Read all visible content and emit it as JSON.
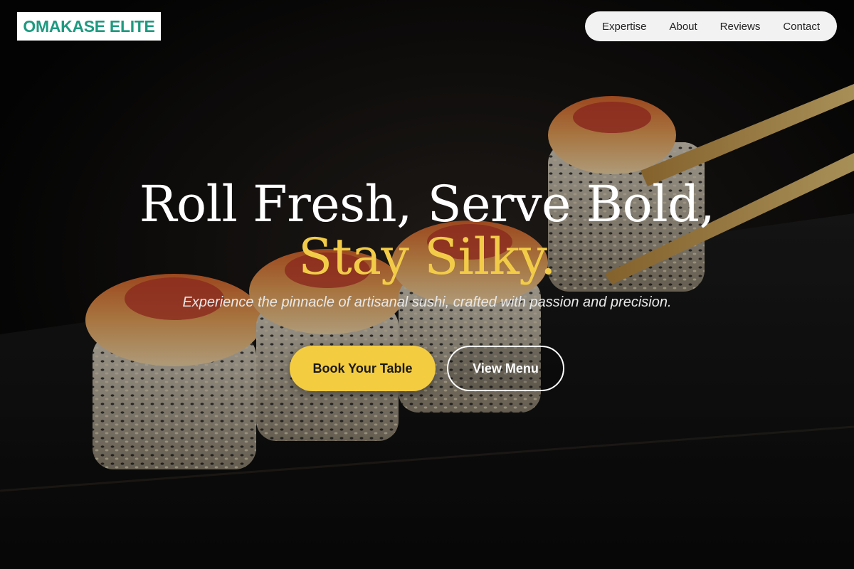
{
  "brand": {
    "logo_text": "OMAKASE ELITE",
    "logo_color": "#1f9a80"
  },
  "nav": {
    "items": [
      {
        "label": "Expertise"
      },
      {
        "label": "About"
      },
      {
        "label": "Reviews"
      },
      {
        "label": "Contact"
      }
    ]
  },
  "hero": {
    "headline_line1": "Roll Fresh, Serve Bold,",
    "headline_line2": "Stay Silky.",
    "subtitle": "Experience the pinnacle of artisanal sushi, crafted with passion and precision.",
    "accent_color": "#f2cc48",
    "background_image": "sushi-rolls-with-chopsticks"
  },
  "cta": {
    "primary_label": "Book Your Table",
    "secondary_label": "View Menu",
    "primary_color": "#f4cc40"
  }
}
